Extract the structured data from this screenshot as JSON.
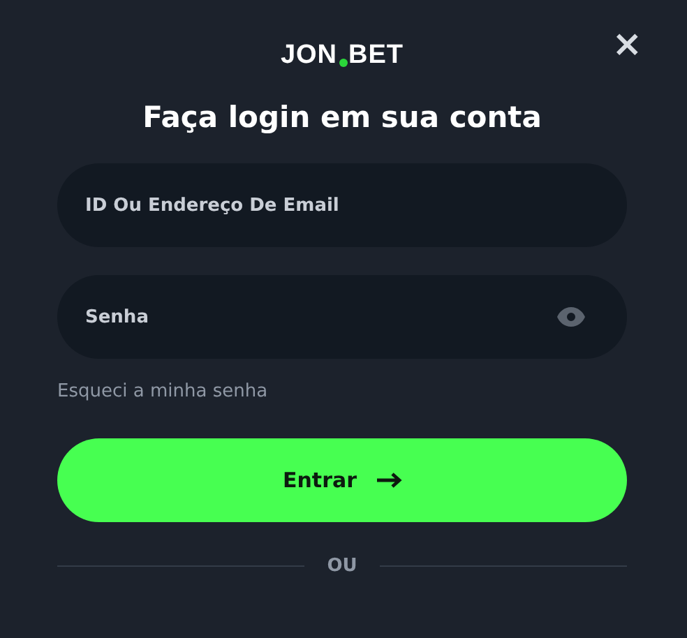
{
  "logo": {
    "left": "JON",
    "right": "BET"
  },
  "close": "×",
  "title": "Faça login em sua conta",
  "fields": [
    {
      "placeholder": "ID Ou Endereço De Email",
      "kind": "text"
    },
    {
      "placeholder": "Senha",
      "kind": "password"
    }
  ],
  "forgot_link": "Esqueci a minha senha",
  "submit": "Entrar",
  "divider": "OU"
}
